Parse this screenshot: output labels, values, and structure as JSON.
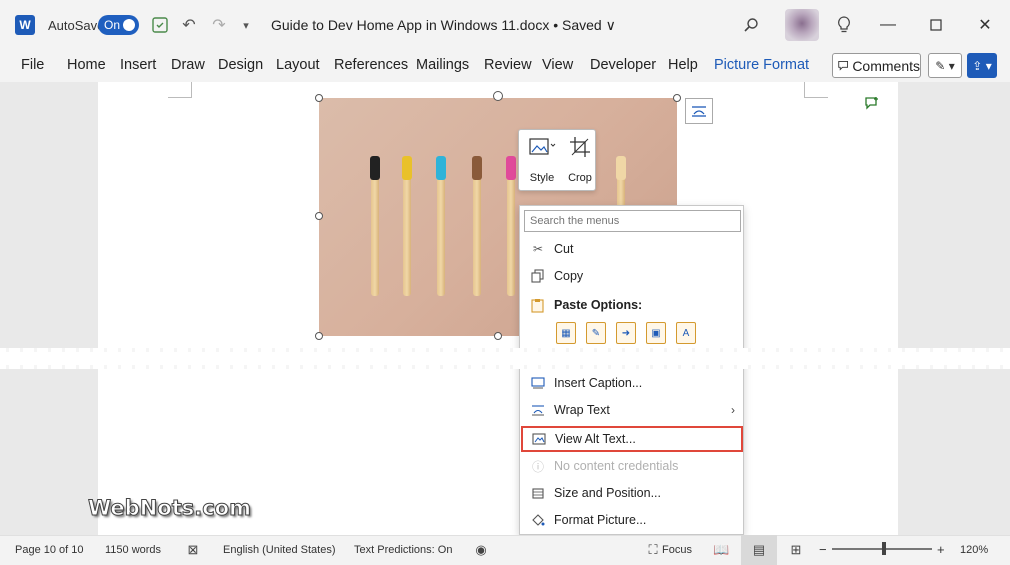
{
  "titlebar": {
    "app_logo_letter": "W",
    "autosave_label": "AutoSave",
    "autosave_state": "On",
    "doc_title": "Guide to Dev Home App in Windows 11.docx • Saved ∨"
  },
  "ribbon": {
    "tabs": [
      "File",
      "Home",
      "Insert",
      "Draw",
      "Design",
      "Layout",
      "References",
      "Mailings",
      "Review",
      "View",
      "Developer",
      "Help",
      "Picture Format"
    ],
    "active_tab": "Picture Format",
    "comments_label": "Comments"
  },
  "mini_toolbar": {
    "style_label": "Style",
    "crop_label": "Crop"
  },
  "context_menu": {
    "search_placeholder": "Search the menus",
    "cut": "Cut",
    "copy": "Copy",
    "paste_options": "Paste Options:",
    "insert_caption": "Insert Caption...",
    "wrap_text": "Wrap Text",
    "view_alt_text": "View Alt Text...",
    "no_content_credentials": "No content credentials",
    "size_and_position": "Size and Position...",
    "format_picture": "Format Picture..."
  },
  "watermark": "WebNots.com",
  "status": {
    "page": "Page 10 of 10",
    "words": "1150 words",
    "language": "English (United States)",
    "text_predictions": "Text Predictions: On",
    "focus": "Focus",
    "zoom": "120%"
  },
  "colors": {
    "accent": "#1e5bb8",
    "highlight_border": "#e0473a"
  }
}
